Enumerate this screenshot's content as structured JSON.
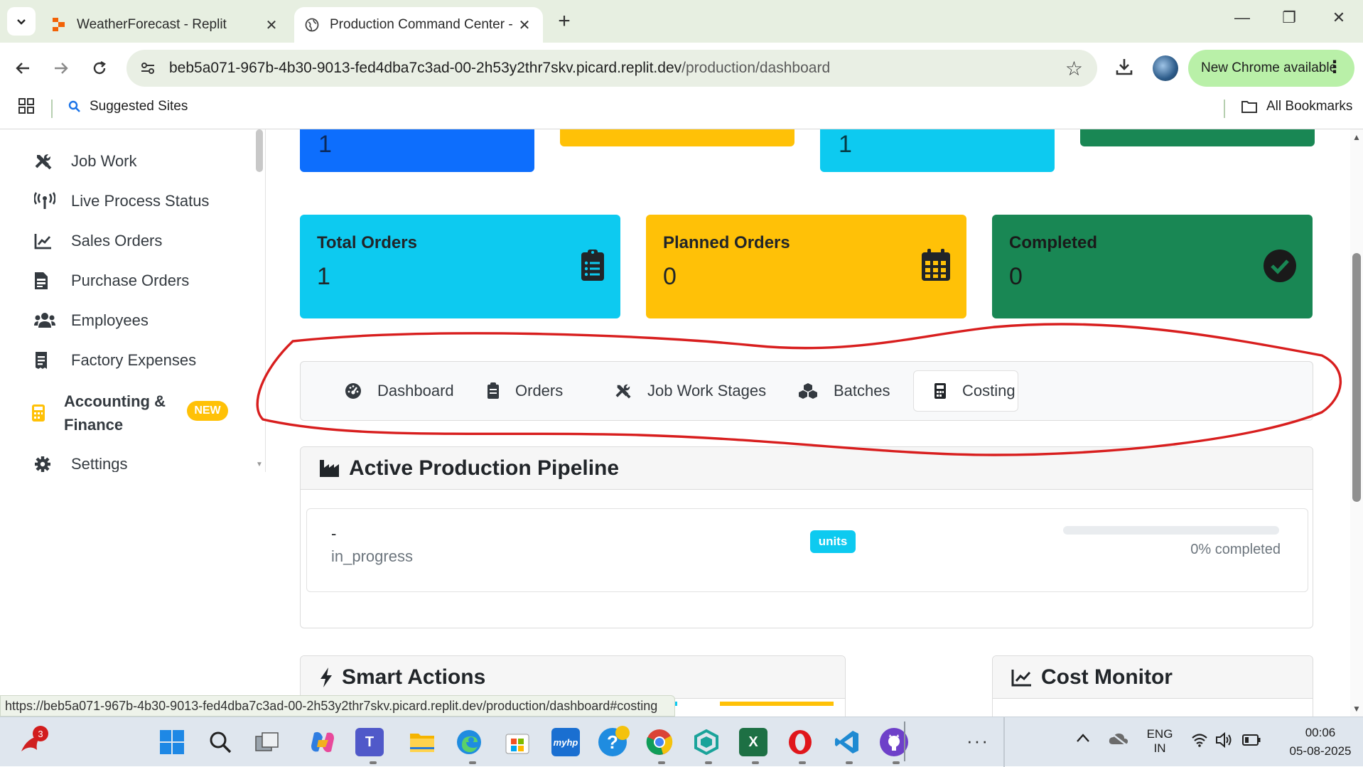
{
  "browser": {
    "tabs": [
      {
        "title": "WeatherForecast - Replit"
      },
      {
        "title": "Production Command Center -"
      }
    ],
    "url_host": "beb5a071-967b-4b30-9013-fed4dba7c3ad-00-2h53y2thr7skv.picard.replit.dev",
    "url_path": "/production/dashboard",
    "update_button": "New Chrome available",
    "bookmarks": {
      "suggested": "Suggested Sites",
      "all": "All Bookmarks"
    },
    "status_url": "https://beb5a071-967b-4b30-9013-fed4dba7c3ad-00-2h53y2thr7skv.picard.replit.dev/production/dashboard#costing"
  },
  "sidebar": {
    "items": [
      {
        "label": "Job Work",
        "icon": "tools-icon"
      },
      {
        "label": "Live Process Status",
        "icon": "broadcast-icon"
      },
      {
        "label": "Sales Orders",
        "icon": "chart-line-icon"
      },
      {
        "label": "Purchase Orders",
        "icon": "file-invoice-icon"
      },
      {
        "label": "Employees",
        "icon": "users-icon"
      },
      {
        "label": "Factory Expenses",
        "icon": "receipt-icon"
      },
      {
        "label": "Accounting & Finance",
        "icon": "calculator-icon",
        "badge": "NEW"
      },
      {
        "label": "Settings",
        "icon": "gear-icon"
      }
    ]
  },
  "top_cards": {
    "card1_value": "1",
    "card3_value": "1"
  },
  "stats": [
    {
      "label": "Total Orders",
      "value": "1",
      "color": "#0dcaf0",
      "text_color": "#212529",
      "icon": "clipboard-list-icon"
    },
    {
      "label": "Planned Orders",
      "value": "0",
      "color": "#ffc107",
      "text_color": "#212529",
      "icon": "calendar-icon"
    },
    {
      "label": "Completed",
      "value": "0",
      "color": "#198754",
      "text_color": "#1a1a1a",
      "icon": "check-circle-icon"
    }
  ],
  "nav_tabs": [
    {
      "label": "Dashboard",
      "icon": "dashboard-icon"
    },
    {
      "label": "Orders",
      "icon": "clipboard-icon"
    },
    {
      "label": "Job Work Stages",
      "icon": "tools-icon"
    },
    {
      "label": "Batches",
      "icon": "cubes-icon"
    },
    {
      "label": "Costing",
      "icon": "calculator-icon",
      "active": true
    }
  ],
  "pipeline": {
    "title": "Active Production Pipeline",
    "item": {
      "name": "-",
      "status": "in_progress",
      "badge": "units",
      "progress": 0,
      "progress_text": "0% completed"
    }
  },
  "smart_actions": {
    "title": "Smart Actions"
  },
  "cost_monitor": {
    "title": "Cost Monitor"
  },
  "taskbar": {
    "notification_count": "3",
    "lang_line1": "ENG",
    "lang_line2": "IN",
    "time": "00:06",
    "date": "05-08-2025"
  },
  "colors": {
    "annotation": "#d81e1e",
    "chrome_frame": "#e7efe1",
    "primary": "#0d6efd"
  }
}
